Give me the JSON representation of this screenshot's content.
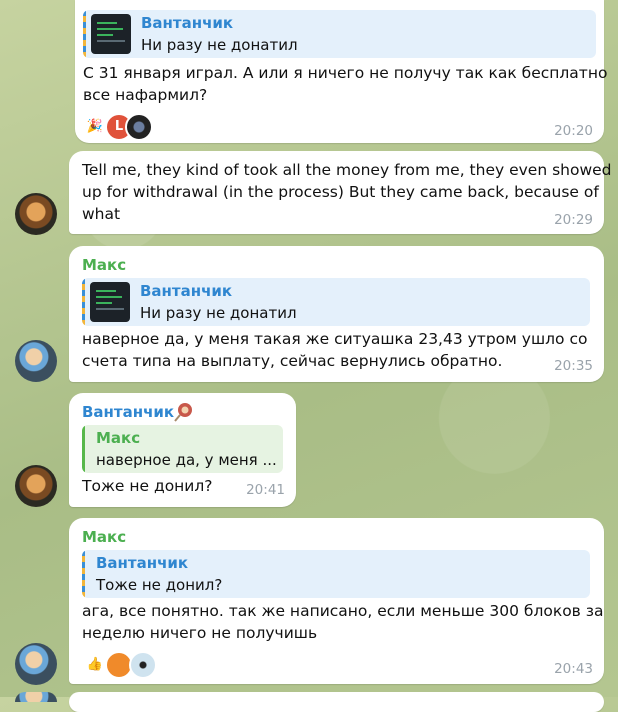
{
  "colors": {
    "sender_blue": "#2f86d0",
    "sender_green": "#4caf50",
    "time_gray": "#9aa3ab"
  },
  "messages": [
    {
      "reply": {
        "name": "Вантанчик",
        "text": "Ни разу не донатил"
      },
      "text_lines": [
        "С 31 января играл. А или я ничего не получу так как бесплатно",
        "все нафармил?"
      ],
      "reactions": [
        {
          "icon": "party-popper-icon"
        },
        {
          "label": "L",
          "icon": "avatar-l-icon"
        },
        {
          "icon": "avatar-dark-icon"
        }
      ],
      "time": "20:20"
    },
    {
      "text_lines": [
        "Tell me, they kind of took all the money from me, they even showed",
        "up for withdrawal (in the process) But they came back, because of",
        "what"
      ],
      "time": "20:29"
    },
    {
      "sender": "Макс",
      "reply": {
        "name": "Вантанчик",
        "text": "Ни разу не донатил"
      },
      "text_lines": [
        "наверное да, у меня такая же ситуашка 23,43 утром ушло со",
        "счета типа на выплату, сейчас вернулись обратно."
      ],
      "time": "20:35"
    },
    {
      "sender": "Вантанчик",
      "reply": {
        "name": "Макс",
        "text": "наверное да, у меня ..."
      },
      "text_lines": [
        "Тоже не донил?"
      ],
      "time": "20:41"
    },
    {
      "sender": "Макс",
      "reply": {
        "name": "Вантанчик",
        "text": "Тоже не донил?"
      },
      "text_lines": [
        "ага, все понятно. так же написано, если меньше 300 блоков за",
        "неделю ничего не получишь"
      ],
      "reactions": [
        {
          "icon": "thumbs-up-icon"
        },
        {
          "icon": "avatar-orange-icon"
        },
        {
          "icon": "avatar-sunglasses-icon"
        }
      ],
      "time": "20:43"
    }
  ]
}
